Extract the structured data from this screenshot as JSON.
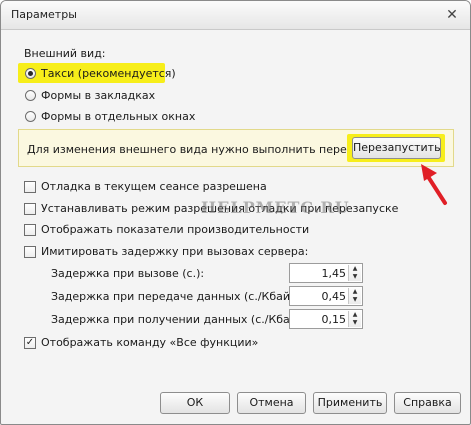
{
  "window": {
    "title": "Параметры",
    "close_glyph": "✕"
  },
  "appearance": {
    "heading": "Внешний вид:",
    "options": [
      {
        "label": "Такси (рекомендуется)",
        "checked": true
      },
      {
        "label": "Формы в закладках",
        "checked": false
      },
      {
        "label": "Формы в отдельных окнах",
        "checked": false
      }
    ]
  },
  "notice": {
    "text": "Для изменения внешнего вида нужно выполнить перезапуск.",
    "restart_label": "Перезапустить"
  },
  "checkboxes": {
    "debug": "Отладка в текущем сеансе разрешена",
    "debug_mode_start": "Устанавливать режим разрешения отладки при перезапуске",
    "show_performance": "Отображать показатели производительности",
    "simulate_delay": "Имитировать задержку при вызовах сервера:",
    "show_all_functions": "Отображать команду «Все функции»",
    "show_all_functions_checked": true
  },
  "delays": [
    {
      "label": "Задержка при вызове (с.):",
      "value": "1,45"
    },
    {
      "label": "Задержка при передаче данных (с./Кбайт):",
      "value": "0,45"
    },
    {
      "label": "Задержка при получении данных (с./Кбайт):",
      "value": "0,15"
    }
  ],
  "watermark": "HELPMETC.RU",
  "footer": {
    "ok": "ОК",
    "cancel": "Отмена",
    "apply": "Применить",
    "help": "Справка"
  },
  "colors": {
    "highlight": "#f7ee1a",
    "arrow": "#e01f26"
  },
  "icons": {
    "close": "close-icon",
    "arrow": "red-arrow-icon"
  }
}
